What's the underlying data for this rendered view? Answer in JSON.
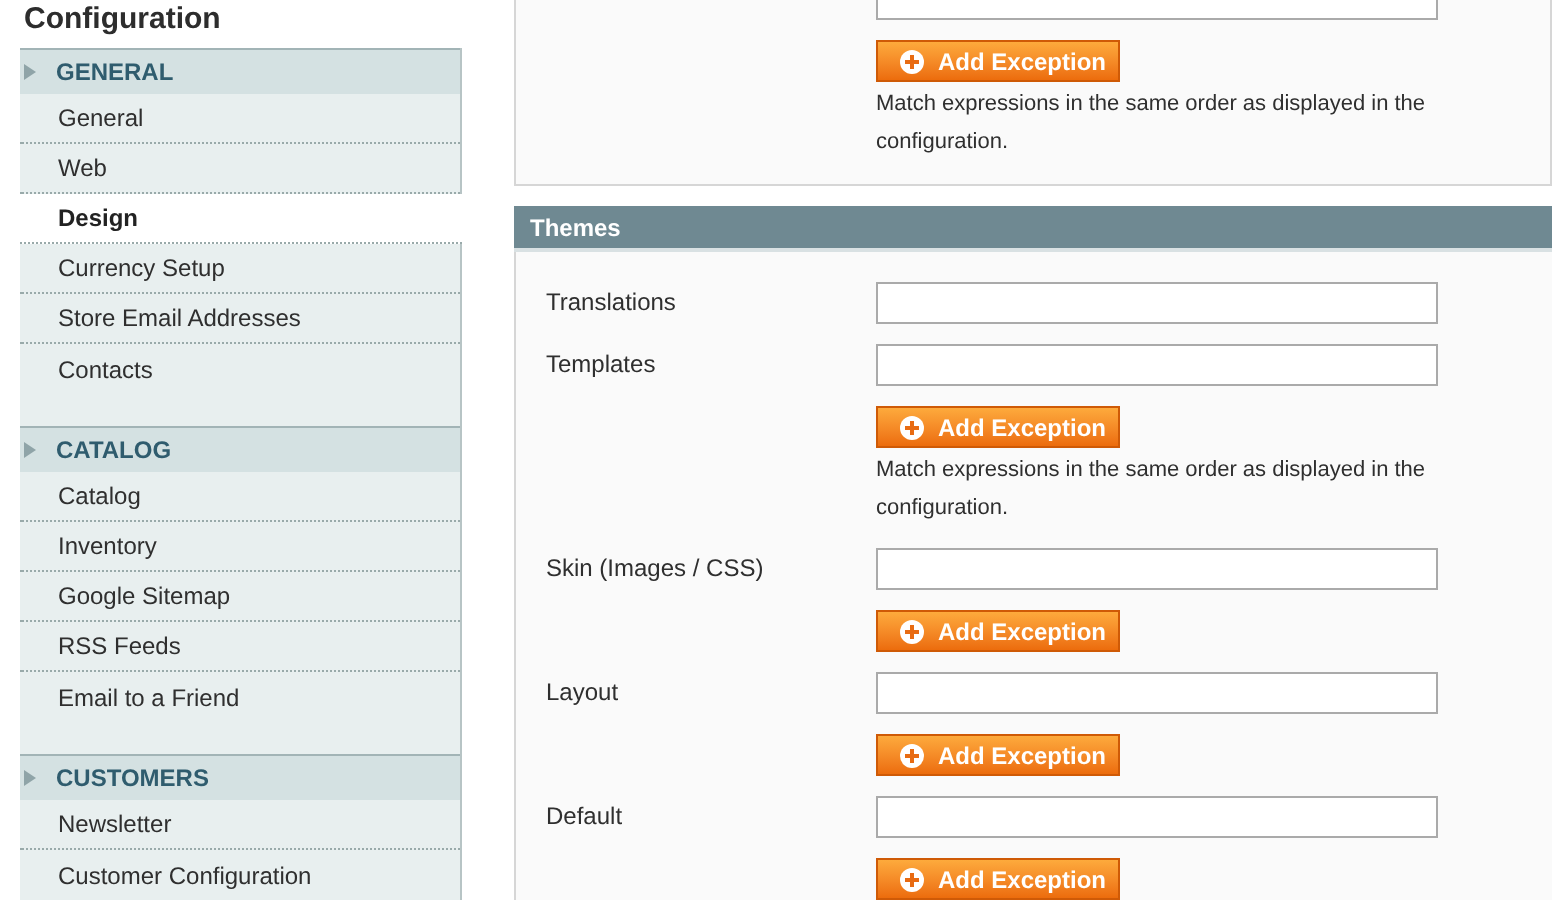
{
  "sidebar": {
    "title": "Configuration",
    "sections": [
      {
        "title": "GENERAL",
        "items": [
          {
            "label": "General",
            "selected": false
          },
          {
            "label": "Web",
            "selected": false
          },
          {
            "label": "Design",
            "selected": true
          },
          {
            "label": "Currency Setup",
            "selected": false
          },
          {
            "label": "Store Email Addresses",
            "selected": false
          },
          {
            "label": "Contacts",
            "selected": false
          }
        ]
      },
      {
        "title": "CATALOG",
        "items": [
          {
            "label": "Catalog",
            "selected": false
          },
          {
            "label": "Inventory",
            "selected": false
          },
          {
            "label": "Google Sitemap",
            "selected": false
          },
          {
            "label": "RSS Feeds",
            "selected": false
          },
          {
            "label": "Email to a Friend",
            "selected": false
          }
        ]
      },
      {
        "title": "CUSTOMERS",
        "items": [
          {
            "label": "Newsletter",
            "selected": false
          },
          {
            "label": "Customer Configuration",
            "selected": false
          }
        ]
      }
    ]
  },
  "package_section": {
    "button": "Add Exception",
    "note": "Match expressions in the same order as displayed in the configuration."
  },
  "themes": {
    "title": "Themes",
    "rows": [
      {
        "label": "Translations"
      },
      {
        "label": "Templates",
        "button": "Add Exception",
        "note": "Match expressions in the same order as displayed in the configuration."
      },
      {
        "label": "Skin (Images / CSS)",
        "button": "Add Exception"
      },
      {
        "label": "Layout",
        "button": "Add Exception"
      },
      {
        "label": "Default",
        "button": "Add Exception"
      }
    ]
  }
}
